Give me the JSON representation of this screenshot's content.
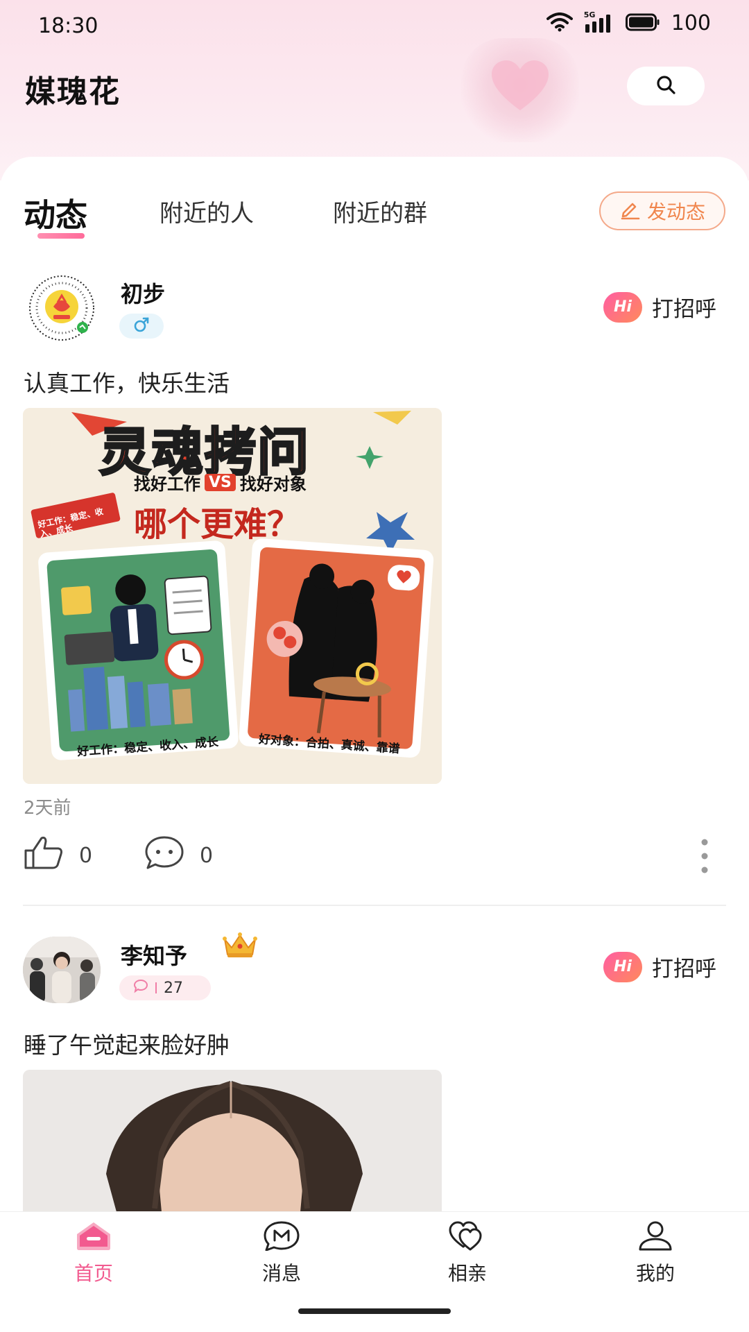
{
  "status_bar": {
    "time": "18:30",
    "network": "5G",
    "battery": "100"
  },
  "app": {
    "title": "媒瑰花"
  },
  "tabs": [
    {
      "label": "动态",
      "active": true
    },
    {
      "label": "附近的人",
      "active": false
    },
    {
      "label": "附近的群",
      "active": false
    }
  ],
  "post_button": {
    "label": "发动态"
  },
  "posts": [
    {
      "username": "初步",
      "gender_icon": "male-icon",
      "greet_label": "打招呼",
      "hi_text": "Hi",
      "text": "认真工作，快乐生活",
      "image": {
        "headline": "灵魂拷问",
        "subtitle_left": "找好工作",
        "vs": "VS",
        "subtitle_right": "找好对象",
        "question": "哪个更难？",
        "tag": "好工作：稳定、收入、成长",
        "caption_left": "好工作：稳定、收入、成长",
        "caption_right": "好对象：合拍、真诚、靠谱"
      },
      "time": "2天前",
      "likes": "0",
      "comments": "0"
    },
    {
      "username": "李知予",
      "badge_icon": "crown-icon",
      "chat_count": "27",
      "greet_label": "打招呼",
      "hi_text": "Hi",
      "text": "睡了午觉起来脸好肿"
    }
  ],
  "nav": [
    {
      "label": "首页",
      "icon": "home-icon",
      "active": true
    },
    {
      "label": "消息",
      "icon": "message-icon",
      "active": false
    },
    {
      "label": "相亲",
      "icon": "hearts-icon",
      "active": false
    },
    {
      "label": "我的",
      "icon": "profile-icon",
      "active": false
    }
  ],
  "colors": {
    "accent": "#f25a8f",
    "post_button": "#f0864e",
    "hi_gradient_start": "#ff5da2",
    "hi_gradient_end": "#ff8a5b"
  }
}
